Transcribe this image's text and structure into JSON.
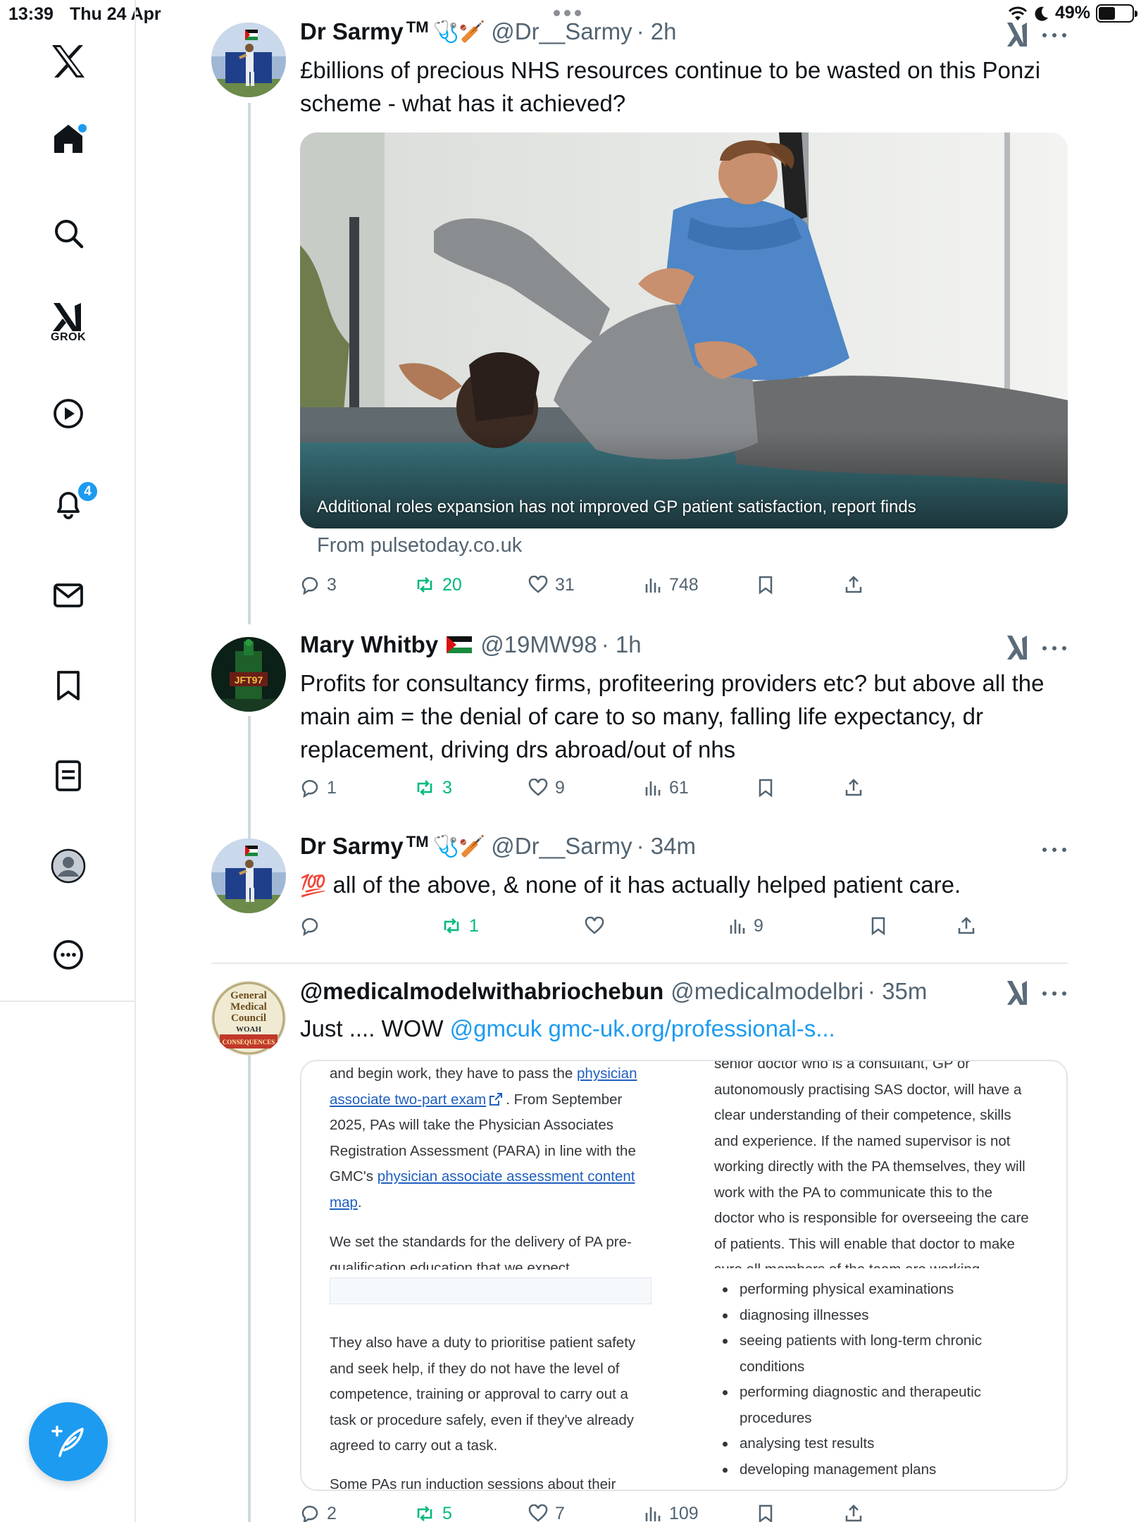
{
  "status_bar": {
    "time": "13:39",
    "date": "Thu 24 Apr",
    "battery": "49%",
    "battery_level": 0.49
  },
  "sidebar": {
    "grok_label": "GROK",
    "notifications_badge": "4",
    "home_has_new": true,
    "icons": [
      "x-logo-icon",
      "home-icon",
      "search-icon",
      "grok-icon",
      "video-icon",
      "bell-icon",
      "mail-icon",
      "bookmark-icon",
      "lists-icon",
      "profile-icon",
      "more-icon",
      "compose-icon"
    ]
  },
  "tweets": [
    {
      "name": "Dr Sarmy",
      "tm": "TM",
      "badges": "🩺🏏",
      "handle": "@Dr__Sarmy",
      "time": "· 2h",
      "text": "£billions of precious NHS resources continue to be wasted on this Ponzi scheme - what has it achieved?",
      "card": {
        "caption": "Additional roles expansion has not improved GP patient satisfaction, report finds",
        "source": "From pulsetoday.co.uk"
      },
      "stats": {
        "replies": "3",
        "reposts": "20",
        "likes": "31",
        "views": "748"
      }
    },
    {
      "name": "Mary Whitby",
      "flag": "palestine-flag",
      "handle": "@19MW98",
      "time": "· 1h",
      "avatar_text": "JFT97",
      "text": "Profits for consultancy firms, profiteering providers etc? but above all the main aim = the  denial of care to so many, falling life expectancy, dr replacement, driving drs abroad/out of nhs",
      "stats": {
        "replies": "1",
        "reposts": "3",
        "likes": "9",
        "views": "61"
      }
    },
    {
      "name": "Dr Sarmy",
      "tm": "TM",
      "badges": "🩺🏏",
      "handle": "@Dr__Sarmy",
      "time": "· 34m",
      "emoji": "💯",
      "text": "all of the above, & none of it has actually helped patient care.",
      "stats": {
        "replies": "",
        "reposts": "1",
        "likes": "",
        "views": "9"
      }
    },
    {
      "name": "@medicalmodelwithabriochebun",
      "handle": "@medicalmodelbri",
      "time": "· 35m",
      "avatar_lines": [
        "General",
        "Medical",
        "Council",
        "WOAH",
        "CONSEQUENCES"
      ],
      "text_plain": "Just .... WOW ",
      "text_mention": "@gmcuk",
      "text_link": "gmc-uk.org/professional-s...",
      "stats": {
        "replies": "2",
        "reposts": "5",
        "likes": "7",
        "views": "109"
      }
    }
  ],
  "doc": {
    "left": {
      "l1": "and begin work, they have to pass the ",
      "l1_link": "physician",
      "l2_link": "associate two-part exam",
      "l2": ". From September",
      "l3": "2025, PAs will take the Physician Associates",
      "l4": "Registration Assessment (PARA) in line with the",
      "l5": "GMC's ",
      "l5_link": "physician associate assessment content",
      "l6_link": "map",
      "l6": ".",
      "p2a": "We set the standards for the delivery of PA pre-",
      "p2b": "qualification education that we expect",
      "p3": [
        "They also have a duty to prioritise patient safety",
        "and seek help, if they do not have the level of",
        "competence, training or approval to carry out a",
        "task or procedure safely, even if they've already",
        "agreed to carry out a task."
      ],
      "p4": "Some PAs run induction sessions about their"
    },
    "right": {
      "lines": [
        "senior doctor who is a consultant, GP or",
        "autonomously practising SAS doctor, will have a",
        "clear understanding of their competence, skills",
        "and experience. If the named supervisor is not",
        "working directly with the PA themselves, they will",
        "work with the PA to communicate this to the",
        "doctor who is responsible for overseeing the care",
        "of patients. This will enable that doctor to make",
        "sure all members of the team are working"
      ],
      "bullets": [
        "performing physical examinations",
        "diagnosing illnesses",
        "seeing patients with long-term chronic conditions",
        "performing diagnostic and therapeutic procedures",
        "analysing test results",
        "developing management plans"
      ]
    }
  },
  "colors": {
    "accent": "#1d9bf0",
    "repost": "#00ba7c",
    "muted": "#536471",
    "text": "#0f1419"
  }
}
